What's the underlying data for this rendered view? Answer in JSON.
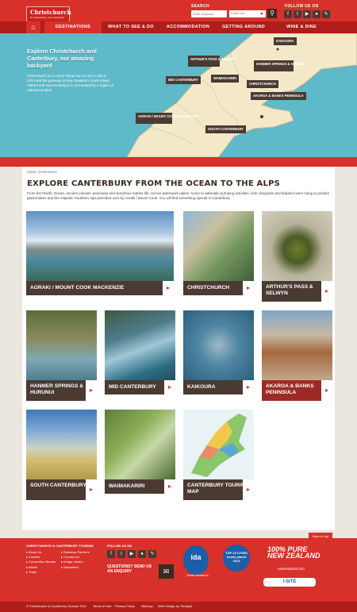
{
  "header": {
    "logo_name": "Christchurch",
    "logo_tagline": "& Canterbury, New Zealand",
    "search_label": "SEARCH",
    "search_placeholder": "Enter Keyword",
    "search_scope": "Entire site",
    "follow_label": "FOLLOW US ON",
    "social_icons": [
      "facebook-icon",
      "twitter-icon",
      "youtube-icon",
      "flickr-icon",
      "blog-icon"
    ]
  },
  "nav": {
    "items": [
      "DESTINATIONS",
      "WHAT TO SEE & DO",
      "ACCOMMODATION",
      "GETTING AROUND",
      "WINE & DINE"
    ]
  },
  "hero": {
    "title": "Explore Christchurch and Canterbury, our amazing backyard",
    "text": "Christchurch is a Lonely Planet top 10 city to visit in 2013 and the gateway to New Zealand's South Island. Vibrant and ever-evolving it is surrounded by a region of natural wonders.",
    "map_labels": [
      "KAIKOURA",
      "ARTHUR'S PASS & SELWYN",
      "HANMER SPRINGS & HURUNUI",
      "MID CANTERBURY",
      "WAIMAKARIRI",
      "CHRISTCHURCH",
      "AKAROA & BANKS PENINSULA",
      "AORAKI / MOUNT COOK MACKENZIE",
      "SOUTH CANTERBURY"
    ]
  },
  "breadcrumb": {
    "home": "Home",
    "current": "Destinations"
  },
  "section_title": "EXPLORE CANTERBURY FROM THE OCEAN TO THE ALPS",
  "intro": "From the Pacific Ocean, ancient volcanic peninsula and wondrous marine life, across patchwork plains, home to adrenalin pumping activities, lush vineyards and braided rivers rising to pristine glacial lakes and the majestic Southern Alps presided over by Aoraki / Mount Cook. You will find something special in Canterbury.",
  "cards": [
    "AORAKI / MOUNT COOK MACKENZIE",
    "CHRISTCHURCH",
    "ARTHUR'S PASS & SELWYN",
    "HANMER SPRINGS & HURUNUI",
    "MID CANTERBURY",
    "KAIKOURA",
    "AKAROA & BANKS PENINSULA",
    "SOUTH CANTERBURY",
    "WAIMAKARIRI",
    "CANTERBURY TOURING MAP"
  ],
  "back_to_top": "Back to top",
  "footer": {
    "tourism_heading": "CHRISTCHURCH & CANTERBURY TOURISM",
    "links_col1": [
      "About Us",
      "Careers",
      "Convention Bureau",
      "Media",
      "Trade"
    ],
    "links_col2": [
      "Business Partners",
      "Contact Us",
      "Image Library",
      "Newsletter"
    ],
    "follow_heading": "FOLLOW US ON",
    "question": "QUESTIONS? SEND US AN ENQUIRY",
    "ida_text": "ida",
    "ida_caption": "Aoraki Mackenzie",
    "lonely_planet": "TOP 10 CITIES lonely planet 2013",
    "pure_nz": "100% PURE NEW ZEALAND",
    "pure_url": "newzealand.com",
    "site_badge": "i-SITE",
    "bottom_links": [
      "© Christchurch & Canterbury Tourism 2012",
      "Terms of Use",
      "Privacy Policy",
      "Sitemap",
      "Web Design by Terabyte"
    ]
  },
  "colors": {
    "brand_red": "#d8302a",
    "dark_brown": "#4a3a32",
    "sea_blue": "#5eb9c9",
    "land": "#f3e9c9"
  }
}
